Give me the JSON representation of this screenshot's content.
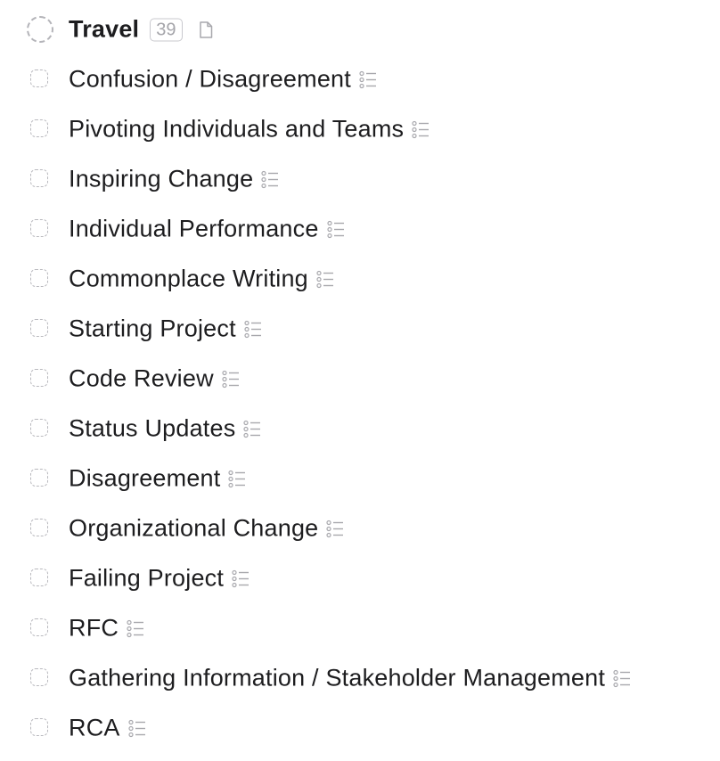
{
  "header": {
    "title": "Travel",
    "count": "39",
    "note_icon": "document-icon"
  },
  "checklists": [
    {
      "label": "Confusion / Disagreement",
      "icon": "checklist-icon"
    },
    {
      "label": "Pivoting Individuals and Teams",
      "icon": "checklist-icon"
    },
    {
      "label": "Inspiring Change",
      "icon": "checklist-icon"
    },
    {
      "label": "Individual Performance",
      "icon": "checklist-icon"
    },
    {
      "label": "Commonplace Writing",
      "icon": "checklist-icon"
    },
    {
      "label": "Starting Project",
      "icon": "checklist-icon"
    },
    {
      "label": "Code Review",
      "icon": "checklist-icon"
    },
    {
      "label": "Status Updates",
      "icon": "checklist-icon"
    },
    {
      "label": "Disagreement",
      "icon": "checklist-icon"
    },
    {
      "label": "Organizational Change",
      "icon": "checklist-icon"
    },
    {
      "label": "Failing Project",
      "icon": "checklist-icon"
    },
    {
      "label": "RFC",
      "icon": "checklist-icon"
    },
    {
      "label": "Gathering Information / Stakeholder Management",
      "icon": "checklist-icon"
    },
    {
      "label": "RCA",
      "icon": "checklist-icon"
    }
  ],
  "colors": {
    "text": "#1d1d1f",
    "muted": "#b9b9be",
    "background": "#ffffff"
  }
}
